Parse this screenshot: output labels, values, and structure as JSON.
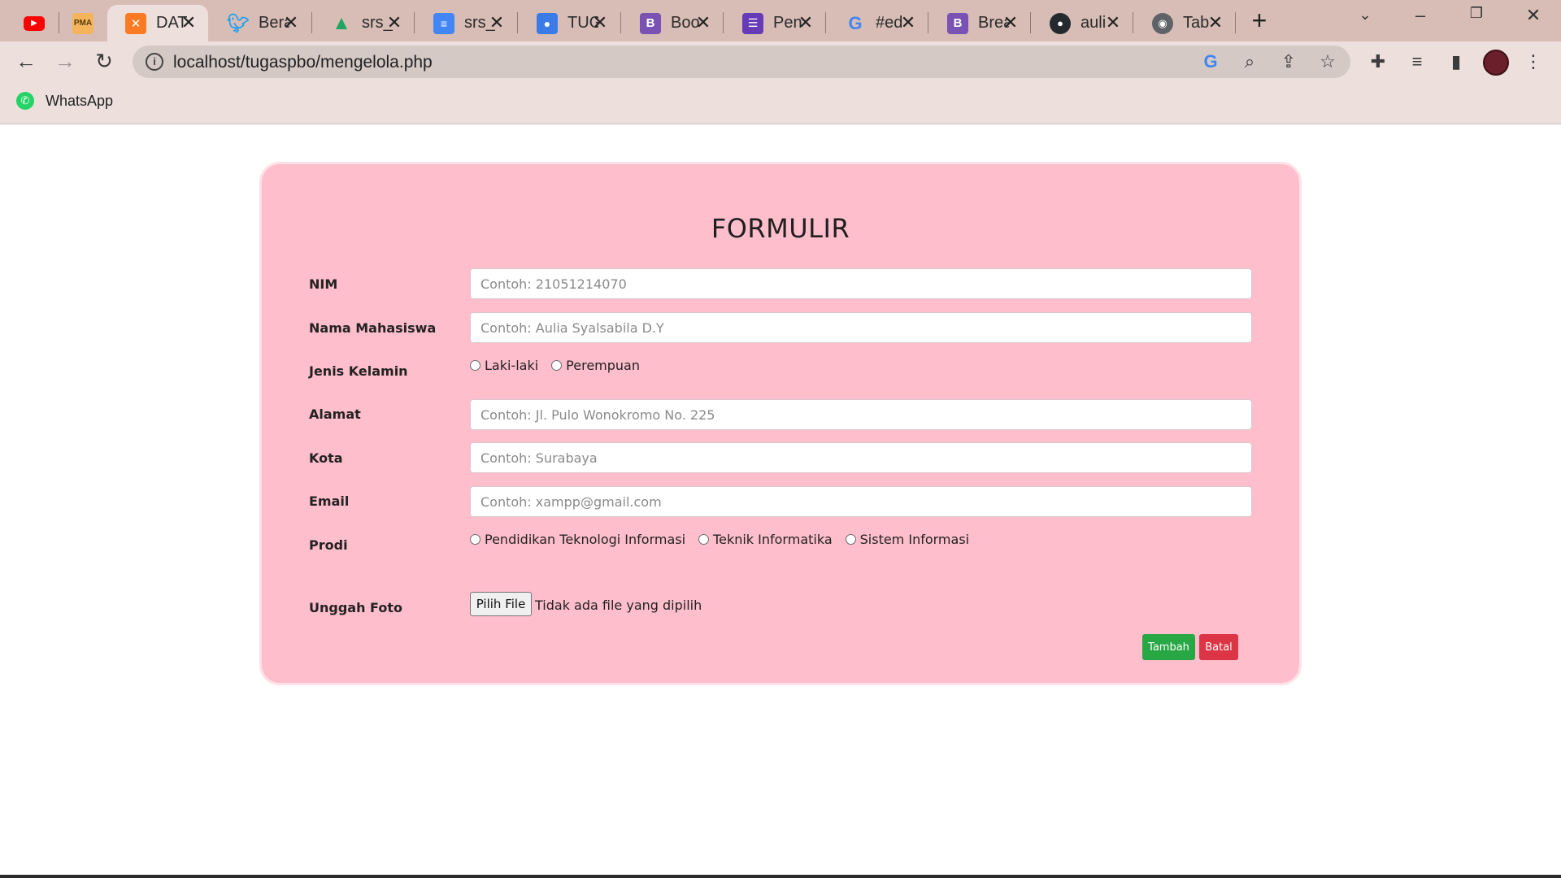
{
  "browser": {
    "tabs": [
      {
        "title": "",
        "icon": "youtube-icon",
        "color": "#ff0000"
      },
      {
        "title": "",
        "icon": "phpmyadmin-icon",
        "color": "#f89c0e"
      },
      {
        "title": "DAT",
        "icon": "xampp-icon",
        "color": "#fb7a24",
        "active": true
      },
      {
        "title": "Bera",
        "icon": "twitter-icon",
        "color": "#1da1f2"
      },
      {
        "title": "srs_",
        "icon": "google-drive-icon",
        "color": "#1fa463"
      },
      {
        "title": "srs_",
        "icon": "google-docs-icon",
        "color": "#4285f4"
      },
      {
        "title": "TUG",
        "icon": "google-classroom-icon",
        "color": "#3b7be8"
      },
      {
        "title": "Boo",
        "icon": "bootstrap-icon",
        "color": "#7952b3"
      },
      {
        "title": "Pen",
        "icon": "google-forms-icon",
        "color": "#673ab7"
      },
      {
        "title": "#ed",
        "icon": "google-icon",
        "color": "#4285f4"
      },
      {
        "title": "Brea",
        "icon": "bootstrap-icon",
        "color": "#7952b3"
      },
      {
        "title": "auli",
        "icon": "github-icon",
        "color": "#24292e"
      },
      {
        "title": "Tab",
        "icon": "chrome-icon",
        "color": "#5f6368"
      }
    ],
    "url": "localhost/tugaspbo/mengelola.php",
    "bookmarks": [
      {
        "label": "WhatsApp",
        "icon": "whatsapp-icon",
        "color": "#25d366"
      }
    ]
  },
  "form": {
    "title": "FORMULIR",
    "nim": {
      "label": "NIM",
      "placeholder": "Contoh: 21051214070"
    },
    "nama": {
      "label": "Nama Mahasiswa",
      "placeholder": "Contoh: Aulia Syalsabila D.Y"
    },
    "gender": {
      "label": "Jenis Kelamin",
      "options": [
        "Laki-laki",
        "Perempuan"
      ]
    },
    "alamat": {
      "label": "Alamat",
      "placeholder": "Contoh: Jl. Pulo Wonokromo No. 225"
    },
    "kota": {
      "label": "Kota",
      "placeholder": "Contoh: Surabaya"
    },
    "email": {
      "label": "Email",
      "placeholder": "Contoh: xampp@gmail.com"
    },
    "prodi": {
      "label": "Prodi",
      "options": [
        "Pendidikan Teknologi Informasi",
        "Teknik Informatika",
        "Sistem Informasi"
      ]
    },
    "foto": {
      "label": "Unggah Foto",
      "button": "Pilih File",
      "status": "Tidak ada file yang dipilih"
    },
    "buttons": {
      "submit": "Tambah",
      "cancel": "Batal"
    },
    "colors": {
      "card": "#ffbecc",
      "submit": "#28a745",
      "cancel": "#dc3545"
    }
  }
}
